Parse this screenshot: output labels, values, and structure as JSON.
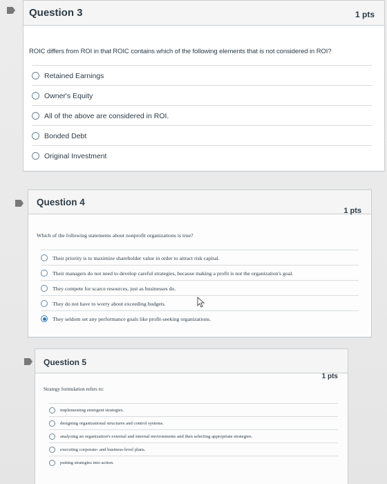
{
  "questions": [
    {
      "title": "Question 3",
      "points": "1 pts",
      "text": "ROIC differs from ROI in that ROIC contains which of the following elements that is not considered in ROI?",
      "answers": [
        "Retained Earnings",
        "Owner's Equity",
        "All of the above are considered in ROI.",
        "Bonded Debt",
        "Original Investment"
      ],
      "selected_index": null
    },
    {
      "title": "Question 4",
      "points": "1 pts",
      "text": "Which of the following statements about nonprofit organizations is true?",
      "answers": [
        "Their priority is to maximize shareholder value in order to attract risk capital.",
        "Their managers do not need to develop careful strategies, because making a profit is not the organization's goal.",
        "They compete for scarce resources, just as businesses do.",
        "They do not have to worry about exceeding budgets.",
        "They seldom set any performance goals like profit-seeking organizations."
      ],
      "selected_index": 4
    },
    {
      "title": "Question 5",
      "points": "1 pts",
      "text": "Strategy formulation refers to:",
      "answers": [
        "implementing emergent strategies.",
        "designing organizational structures and control systems.",
        "analyzing an organization's external and internal environments and then selecting appropriate strategies.",
        "executing corporate- and business-level plans.",
        "putting strategies into action."
      ],
      "selected_index": null
    }
  ],
  "icons": {
    "flag": "flag-icon",
    "radio": "radio-button",
    "cursor": "mouse-cursor-icon"
  },
  "colors": {
    "accent": "#2b7abc",
    "text": "#2d3b45",
    "border": "#c7cdd1",
    "header": "#f5f5f5"
  }
}
